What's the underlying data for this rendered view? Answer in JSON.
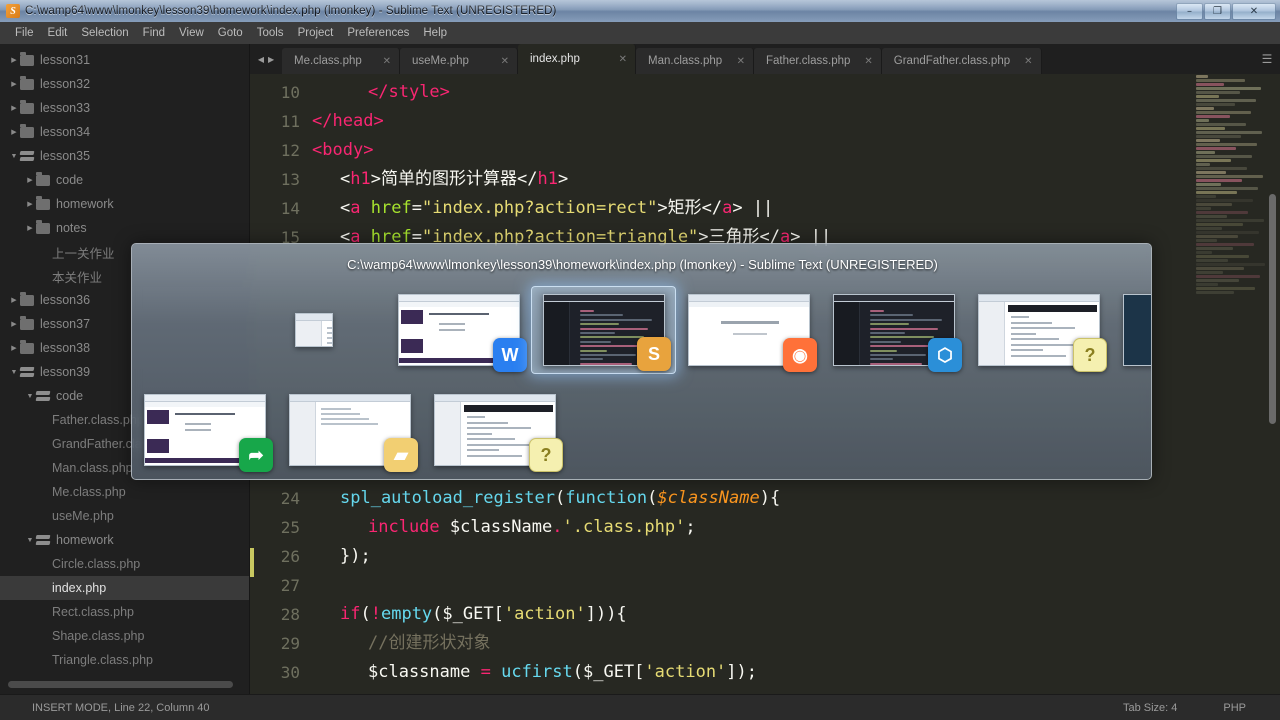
{
  "window": {
    "title": "C:\\wamp64\\www\\lmonkey\\lesson39\\homework\\index.php (lmonkey) - Sublime Text (UNREGISTERED)",
    "app_icon": "sublime-text-icon",
    "controls": {
      "minimize": "–",
      "maximize": "❐",
      "close": "✕"
    }
  },
  "menubar": {
    "items": [
      {
        "label": "File"
      },
      {
        "label": "Edit"
      },
      {
        "label": "Selection"
      },
      {
        "label": "Find"
      },
      {
        "label": "View"
      },
      {
        "label": "Goto"
      },
      {
        "label": "Tools"
      },
      {
        "label": "Project"
      },
      {
        "label": "Preferences"
      },
      {
        "label": "Help"
      }
    ]
  },
  "sidebar": {
    "items": [
      {
        "label": "lesson31",
        "type": "folder",
        "indent": 1,
        "expanded": false
      },
      {
        "label": "lesson32",
        "type": "folder",
        "indent": 1,
        "expanded": false
      },
      {
        "label": "lesson33",
        "type": "folder",
        "indent": 1,
        "expanded": false
      },
      {
        "label": "lesson34",
        "type": "folder",
        "indent": 1,
        "expanded": false
      },
      {
        "label": "lesson35",
        "type": "folder",
        "indent": 1,
        "expanded": true
      },
      {
        "label": "code",
        "type": "folder",
        "indent": 2,
        "expanded": false
      },
      {
        "label": "homework",
        "type": "folder",
        "indent": 2,
        "expanded": false
      },
      {
        "label": "notes",
        "type": "folder",
        "indent": 2,
        "expanded": false
      },
      {
        "label": "上一关作业",
        "type": "file",
        "indent": 3
      },
      {
        "label": "本关作业",
        "type": "file",
        "indent": 3
      },
      {
        "label": "lesson36",
        "type": "folder",
        "indent": 1,
        "expanded": false
      },
      {
        "label": "lesson37",
        "type": "folder",
        "indent": 1,
        "expanded": false
      },
      {
        "label": "lesson38",
        "type": "folder",
        "indent": 1,
        "expanded": false
      },
      {
        "label": "lesson39",
        "type": "folder",
        "indent": 1,
        "expanded": true
      },
      {
        "label": "code",
        "type": "folder",
        "indent": 2,
        "expanded": true
      },
      {
        "label": "Father.class.php",
        "type": "file",
        "indent": 3
      },
      {
        "label": "GrandFather.class.php",
        "type": "file",
        "indent": 3
      },
      {
        "label": "Man.class.php",
        "type": "file",
        "indent": 3
      },
      {
        "label": "Me.class.php",
        "type": "file",
        "indent": 3
      },
      {
        "label": "useMe.php",
        "type": "file",
        "indent": 3
      },
      {
        "label": "homework",
        "type": "folder",
        "indent": 2,
        "expanded": true
      },
      {
        "label": "Circle.class.php",
        "type": "file",
        "indent": 3
      },
      {
        "label": "index.php",
        "type": "file",
        "indent": 3,
        "selected": true
      },
      {
        "label": "Rect.class.php",
        "type": "file",
        "indent": 3
      },
      {
        "label": "Shape.class.php",
        "type": "file",
        "indent": 3
      },
      {
        "label": "Triangle.class.php",
        "type": "file",
        "indent": 3
      }
    ]
  },
  "tabs": {
    "nav_prev": "◀",
    "nav_next": "▶",
    "menu_icon": "hamburger-icon",
    "close_glyph": "✕",
    "items": [
      {
        "label": "Me.class.php",
        "active": false
      },
      {
        "label": "useMe.php",
        "active": false
      },
      {
        "label": "index.php",
        "active": true
      },
      {
        "label": "Man.class.php",
        "active": false
      },
      {
        "label": "Father.class.php",
        "active": false
      },
      {
        "label": "GrandFather.class.php",
        "active": false
      }
    ]
  },
  "code": {
    "visible_top": [
      {
        "num": "10",
        "indent": 2,
        "tokens": [
          {
            "t": "</",
            "c": "tag"
          },
          {
            "t": "style",
            "c": "tag"
          },
          {
            "t": ">",
            "c": "tag"
          }
        ]
      },
      {
        "num": "11",
        "indent": 0,
        "tokens": [
          {
            "t": "</",
            "c": "tag"
          },
          {
            "t": "head",
            "c": "tag"
          },
          {
            "t": ">",
            "c": "tag"
          }
        ]
      },
      {
        "num": "12",
        "indent": 0,
        "tokens": [
          {
            "t": "<",
            "c": "tag"
          },
          {
            "t": "body",
            "c": "tag"
          },
          {
            "t": ">",
            "c": "tag"
          }
        ]
      },
      {
        "num": "13",
        "indent": 1,
        "tokens": [
          {
            "t": "<",
            "c": "cn"
          },
          {
            "t": "h1",
            "c": "tag"
          },
          {
            "t": ">",
            "c": "cn"
          },
          {
            "t": "简单的图形计算器",
            "c": "cn"
          },
          {
            "t": "</",
            "c": "cn"
          },
          {
            "t": "h1",
            "c": "tag"
          },
          {
            "t": ">",
            "c": "cn"
          }
        ]
      },
      {
        "num": "14",
        "indent": 1,
        "tokens": [
          {
            "t": "<",
            "c": "cn"
          },
          {
            "t": "a",
            "c": "tag"
          },
          {
            "t": " ",
            "c": "cn"
          },
          {
            "t": "href",
            "c": "attr"
          },
          {
            "t": "=",
            "c": "cn"
          },
          {
            "t": "\"index.php?action=rect\"",
            "c": "str"
          },
          {
            "t": ">",
            "c": "cn"
          },
          {
            "t": "矩形",
            "c": "cn"
          },
          {
            "t": "</",
            "c": "cn"
          },
          {
            "t": "a",
            "c": "tag"
          },
          {
            "t": "> ||",
            "c": "cn"
          }
        ]
      },
      {
        "num": "15",
        "indent": 1,
        "tokens": [
          {
            "t": "<",
            "c": "cn"
          },
          {
            "t": "a",
            "c": "tag"
          },
          {
            "t": " ",
            "c": "cn"
          },
          {
            "t": "href",
            "c": "attr"
          },
          {
            "t": "=",
            "c": "cn"
          },
          {
            "t": "\"index.php?action=triangle\"",
            "c": "str"
          },
          {
            "t": ">",
            "c": "cn"
          },
          {
            "t": "三角形",
            "c": "cn"
          },
          {
            "t": "</",
            "c": "cn"
          },
          {
            "t": "a",
            "c": "tag"
          },
          {
            "t": "> ||",
            "c": "cn"
          }
        ]
      }
    ],
    "visible_bottom": [
      {
        "num": "24",
        "indent": 1,
        "tokens": [
          {
            "t": "spl_autoload_register",
            "c": "fn"
          },
          {
            "t": "(",
            "c": "cn"
          },
          {
            "t": "function",
            "c": "fn"
          },
          {
            "t": "(",
            "c": "cn"
          },
          {
            "t": "$className",
            "c": "var"
          },
          {
            "t": ")",
            "c": "cn"
          },
          {
            "t": "{",
            "c": "cn"
          }
        ]
      },
      {
        "num": "25",
        "indent": 2,
        "tokens": [
          {
            "t": "include",
            "c": "kw"
          },
          {
            "t": " $className",
            "c": "cn"
          },
          {
            "t": ".",
            "c": "op"
          },
          {
            "t": "'.class.php'",
            "c": "str"
          },
          {
            "t": ";",
            "c": "cn"
          }
        ]
      },
      {
        "num": "26",
        "indent": 1,
        "tokens": [
          {
            "t": "});",
            "c": "cn"
          }
        ]
      },
      {
        "num": "27",
        "indent": 0,
        "tokens": []
      },
      {
        "num": "28",
        "indent": 1,
        "tokens": [
          {
            "t": "if",
            "c": "kw"
          },
          {
            "t": "(",
            "c": "cn"
          },
          {
            "t": "!",
            "c": "op"
          },
          {
            "t": "empty",
            "c": "fn"
          },
          {
            "t": "($_GET[",
            "c": "cn"
          },
          {
            "t": "'action'",
            "c": "str"
          },
          {
            "t": "])){",
            "c": "cn"
          }
        ]
      },
      {
        "num": "29",
        "indent": 2,
        "tokens": [
          {
            "t": "//创建形状对象",
            "c": "com"
          }
        ]
      },
      {
        "num": "30",
        "indent": 2,
        "tokens": [
          {
            "t": "$classname ",
            "c": "cn"
          },
          {
            "t": "=",
            "c": "op"
          },
          {
            "t": " ",
            "c": "cn"
          },
          {
            "t": "ucfirst",
            "c": "fn"
          },
          {
            "t": "($_GET[",
            "c": "cn"
          },
          {
            "t": "'action'",
            "c": "str"
          },
          {
            "t": "]);",
            "c": "cn"
          }
        ]
      }
    ]
  },
  "statusbar": {
    "left": "INSERT MODE, Line 22, Column 40",
    "tab_size": "Tab Size: 4",
    "syntax": "PHP"
  },
  "alt_tab": {
    "title": "C:\\wamp64\\www\\lmonkey\\lesson39\\homework\\index.php (lmonkey) - Sublime Text (UNREGISTERED)",
    "row1": [
      {
        "name": "explorer-window-thumbnail",
        "kind": "mini-explorer",
        "badge": null,
        "selected": false
      },
      {
        "name": "wps-writer-thumbnail",
        "kind": "document",
        "badge": {
          "icon": "wps-icon",
          "glyph": "W",
          "color": "#2a7ff0"
        },
        "selected": false
      },
      {
        "name": "sublime-text-thumbnail",
        "kind": "sublime",
        "badge": {
          "icon": "sublime-icon",
          "glyph": "S",
          "color": "#e8a33d"
        },
        "selected": true
      },
      {
        "name": "firefox-browser-thumbnail",
        "kind": "browser",
        "badge": {
          "icon": "firefox-icon",
          "glyph": "◉",
          "color": "#ff7139"
        },
        "selected": false
      },
      {
        "name": "vscode-thumbnail",
        "kind": "vscode",
        "badge": {
          "icon": "vscode-icon",
          "glyph": "⬡",
          "color": "#2b8fd8"
        },
        "selected": false
      },
      {
        "name": "editplus-thumbnail",
        "kind": "editor-light",
        "badge": {
          "icon": "help-doc-icon",
          "glyph": "?",
          "color": "#f5f0b0"
        },
        "selected": false
      },
      {
        "name": "desktop-thumbnail",
        "kind": "desktop",
        "badge": {
          "icon": "monitor-icon",
          "glyph": "▭",
          "color": "#cfe0f2"
        },
        "selected": false
      }
    ],
    "row2": [
      {
        "name": "teamviewer-thumbnail",
        "kind": "document",
        "badge": {
          "icon": "teamviewer-icon",
          "glyph": "➦",
          "color": "#17a74a"
        },
        "selected": false
      },
      {
        "name": "file-explorer-thumbnail",
        "kind": "explorer",
        "badge": {
          "icon": "folder-icon",
          "glyph": "▰",
          "color": "#f2cf72"
        },
        "selected": false
      },
      {
        "name": "editplus2-thumbnail",
        "kind": "editor-light",
        "badge": {
          "icon": "help-doc-icon",
          "glyph": "?",
          "color": "#f5f0b0"
        },
        "selected": false
      }
    ],
    "cursor": "mouse-pointer"
  },
  "colors": {
    "editor_bg": "#272822",
    "sidebar_bg": "#202020",
    "accent_pink": "#f92672",
    "accent_green": "#a6e22e",
    "accent_yellow": "#e6db74",
    "accent_cyan": "#66d9ef",
    "accent_orange": "#fd971f",
    "comment": "#75715e",
    "titlebar": "#7b93b2"
  }
}
